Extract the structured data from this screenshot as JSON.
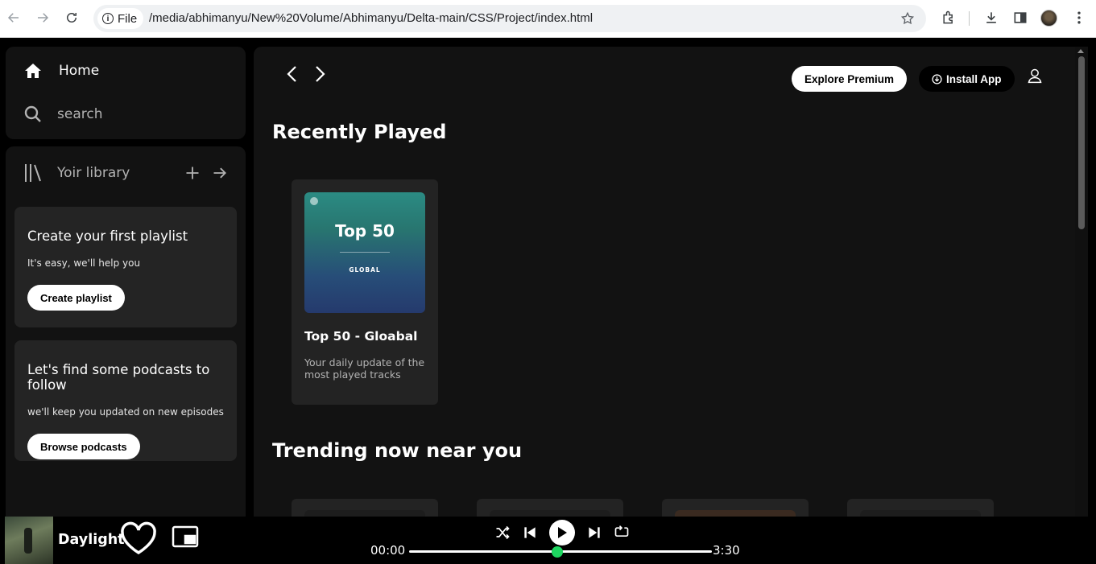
{
  "browser": {
    "file_label": "File",
    "url": "/media/abhimanyu/New%20Volume/Abhimanyu/Delta-main/CSS/Project/index.html"
  },
  "sidebar": {
    "home_label": "Home",
    "search_label": "search",
    "library_label": "Yoir library",
    "playlist_card": {
      "title": "Create your first playlist",
      "subtitle": "It's easy, we'll help you",
      "button": "Create playlist"
    },
    "podcast_card": {
      "title": "Let's find some podcasts to follow",
      "subtitle": "we'll keep you updated on new episodes",
      "button": "Browse podcasts"
    }
  },
  "header": {
    "explore_label": "Explore Premium",
    "install_label": "Install App"
  },
  "main": {
    "recently_played_title": "Recently Played",
    "album": {
      "cover_title": "Top 50",
      "cover_subtitle": "GLOBAL",
      "title": "Top 50 - Gloabal",
      "description": "Your daily update of the most played tracks"
    },
    "trending_title": "Trending now near you"
  },
  "player": {
    "track": "Daylight",
    "current_time": "00:00",
    "total_time": "3:30",
    "progress": 0.49,
    "accent": "#1ed760"
  },
  "icons": [
    "back-icon",
    "forward-icon",
    "reload-icon",
    "info-icon",
    "star-icon",
    "extensions-icon",
    "download-icon",
    "sidebar-icon",
    "home-icon",
    "search-icon",
    "library-icon",
    "plus-icon",
    "arrow-right-icon",
    "chevron-left-icon",
    "chevron-right-icon",
    "download-circle-icon",
    "user-icon",
    "heart-icon",
    "picture-in-picture-icon",
    "shuffle-icon",
    "previous-icon",
    "play-icon",
    "next-icon",
    "repeat-icon"
  ]
}
